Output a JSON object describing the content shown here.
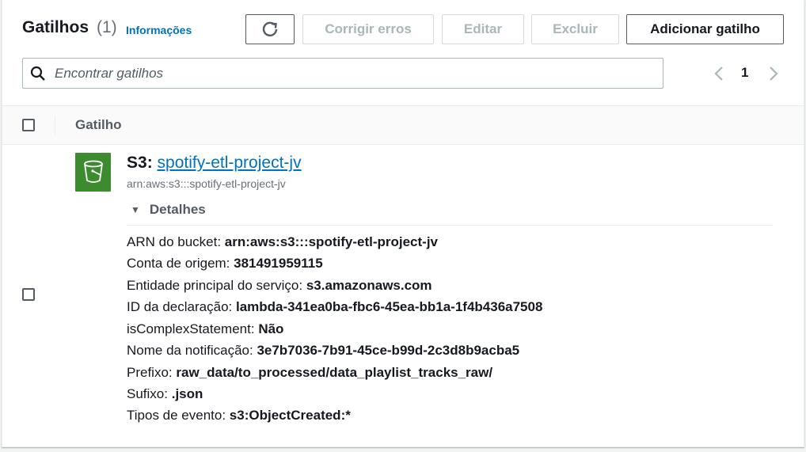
{
  "header": {
    "title": "Gatilhos",
    "count": "(1)",
    "info_link": "Informações",
    "buttons": {
      "fix_errors": "Corrigir erros",
      "edit": "Editar",
      "delete": "Excluir",
      "add_trigger": "Adicionar gatilho"
    }
  },
  "search": {
    "placeholder": "Encontrar gatilhos"
  },
  "pagination": {
    "current_page": "1"
  },
  "table": {
    "column": "Gatilho"
  },
  "trigger": {
    "service": "S3",
    "name": "spotify-etl-project-jv",
    "arn": "arn:aws:s3:::spotify-etl-project-jv",
    "details_label": "Detalhes",
    "details": [
      {
        "label": "ARN do bucket:",
        "value": "arn:aws:s3:::spotify-etl-project-jv"
      },
      {
        "label": "Conta de origem:",
        "value": "381491959115"
      },
      {
        "label": "Entidade principal do serviço:",
        "value": "s3.amazonaws.com"
      },
      {
        "label": "ID da declaração:",
        "value": "lambda-341ea0ba-fbc6-45ea-bb1a-1f4b436a7508"
      },
      {
        "label": "isComplexStatement:",
        "value": "Não"
      },
      {
        "label": "Nome da notificação:",
        "value": "3e7b7036-7b91-45ce-b99d-2c3d8b9acba5"
      },
      {
        "label": "Prefixo:",
        "value": "raw_data/to_processed/data_playlist_tracks_raw/"
      },
      {
        "label": "Sufixo:",
        "value": ".json"
      },
      {
        "label": "Tipos de evento:",
        "value": "s3:ObjectCreated:*"
      }
    ]
  },
  "icons": {
    "refresh": "refresh-icon",
    "search": "search-icon",
    "prev": "chevron-left-icon",
    "next": "chevron-right-icon",
    "service": "s3-bucket-icon",
    "expand": "caret-down-icon"
  },
  "colors": {
    "link": "#0073bb",
    "s3_green": "#3d8b2f",
    "disabled_text": "#aab7b8"
  }
}
